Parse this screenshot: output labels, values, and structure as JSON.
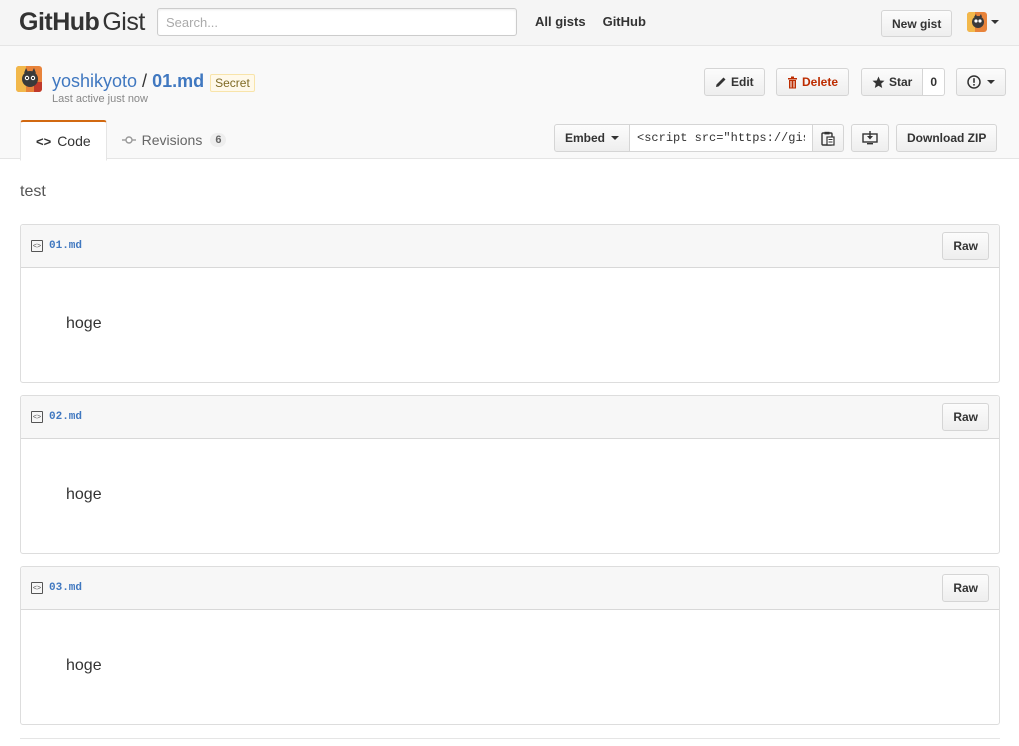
{
  "header": {
    "logo_bold": "GitHub",
    "logo_light": "Gist",
    "search_placeholder": "Search...",
    "nav": [
      "All gists",
      "GitHub"
    ],
    "new_gist": "New gist"
  },
  "gist": {
    "owner": "yoshikyoto",
    "separator": "/",
    "title": "01.md",
    "visibility_badge": "Secret",
    "last_active": "Last active just now",
    "description": "test"
  },
  "actions": {
    "edit": "Edit",
    "delete": "Delete",
    "star": "Star",
    "star_count": "0"
  },
  "tabs": {
    "code": "Code",
    "revisions": "Revisions",
    "revisions_count": "6"
  },
  "embed": {
    "label": "Embed",
    "value": "<script src=\"https://gist",
    "download_zip": "Download ZIP"
  },
  "files": [
    {
      "name": "01.md",
      "raw_label": "Raw",
      "content": "hoge"
    },
    {
      "name": "02.md",
      "raw_label": "Raw",
      "content": "hoge"
    },
    {
      "name": "03.md",
      "raw_label": "Raw",
      "content": "hoge"
    }
  ],
  "colors": {
    "link": "#4078c0",
    "tab_accent": "#d26911",
    "danger": "#bd2c00",
    "badge_bg": "#fff9ea"
  },
  "icons": {
    "edit": "pencil-icon",
    "delete": "trash-icon",
    "star": "star-icon",
    "report": "alert-icon",
    "code": "code-icon",
    "revisions": "git-commit-icon",
    "clipboard": "clipboard-icon",
    "desktop_download": "desktop-download-icon",
    "file": "file-code-icon"
  }
}
